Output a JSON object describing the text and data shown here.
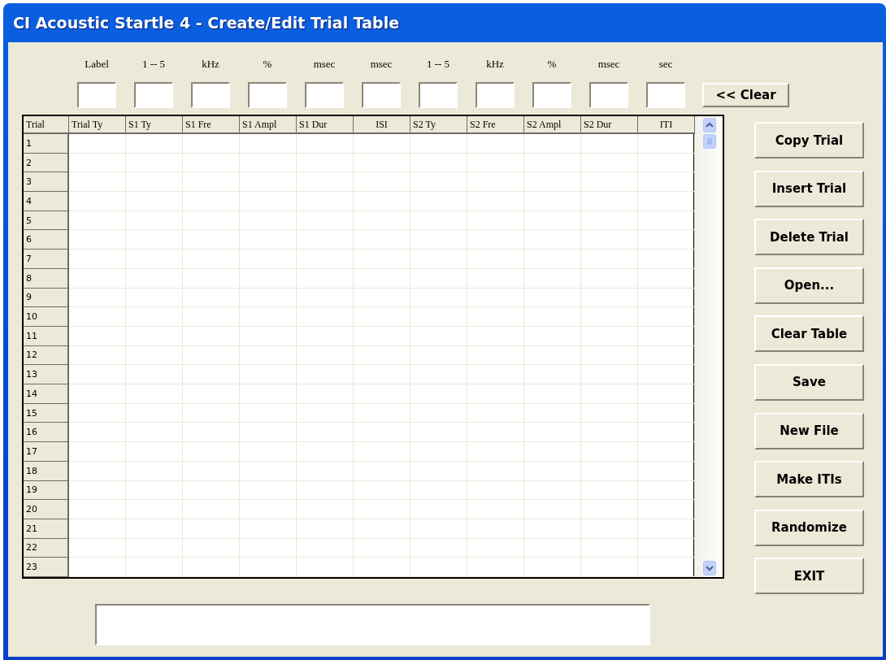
{
  "window": {
    "title": "CI Acoustic Startle 4 - Create/Edit Trial Table"
  },
  "entry_fields": [
    {
      "unit": "Label"
    },
    {
      "unit": "1 -- 5"
    },
    {
      "unit": "kHz"
    },
    {
      "unit": "%"
    },
    {
      "unit": "msec"
    },
    {
      "unit": "msec"
    },
    {
      "unit": "1 -- 5"
    },
    {
      "unit": "kHz"
    },
    {
      "unit": "%"
    },
    {
      "unit": "msec"
    },
    {
      "unit": "sec"
    }
  ],
  "clear_button": "<< Clear",
  "table": {
    "columns": [
      "Trial",
      "Trial Ty",
      "S1 Ty",
      "S1 Fre",
      "S1 Ampl",
      "S1 Dur",
      "ISI",
      "S2 Ty",
      "S2 Fre",
      "S2 Ampl",
      "S2 Dur",
      "ITI"
    ],
    "rows": [
      "1",
      "2",
      "3",
      "4",
      "5",
      "6",
      "7",
      "8",
      "9",
      "10",
      "11",
      "12",
      "13",
      "14",
      "15",
      "16",
      "17",
      "18",
      "19",
      "20",
      "21",
      "22",
      "23"
    ]
  },
  "buttons": [
    "Copy Trial",
    "Insert Trial",
    "Delete Trial",
    "Open...",
    "Clear Table",
    "Save",
    "New File",
    "Make ITIs",
    "Randomize",
    "EXIT"
  ]
}
